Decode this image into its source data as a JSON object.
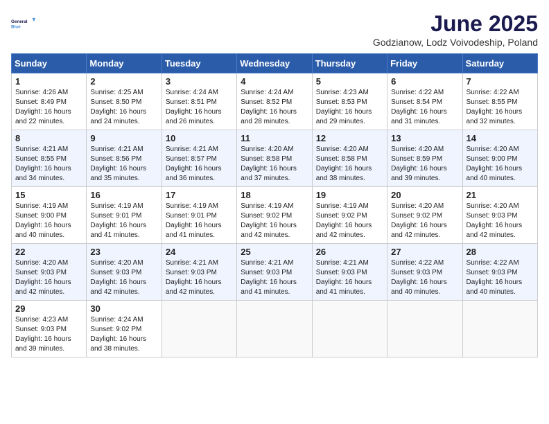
{
  "header": {
    "logo_line1": "General",
    "logo_line2": "Blue",
    "title": "June 2025",
    "subtitle": "Godzianow, Lodz Voivodeship, Poland"
  },
  "days_of_week": [
    "Sunday",
    "Monday",
    "Tuesday",
    "Wednesday",
    "Thursday",
    "Friday",
    "Saturday"
  ],
  "weeks": [
    [
      {
        "day": "1",
        "info": "Sunrise: 4:26 AM\nSunset: 8:49 PM\nDaylight: 16 hours\nand 22 minutes."
      },
      {
        "day": "2",
        "info": "Sunrise: 4:25 AM\nSunset: 8:50 PM\nDaylight: 16 hours\nand 24 minutes."
      },
      {
        "day": "3",
        "info": "Sunrise: 4:24 AM\nSunset: 8:51 PM\nDaylight: 16 hours\nand 26 minutes."
      },
      {
        "day": "4",
        "info": "Sunrise: 4:24 AM\nSunset: 8:52 PM\nDaylight: 16 hours\nand 28 minutes."
      },
      {
        "day": "5",
        "info": "Sunrise: 4:23 AM\nSunset: 8:53 PM\nDaylight: 16 hours\nand 29 minutes."
      },
      {
        "day": "6",
        "info": "Sunrise: 4:22 AM\nSunset: 8:54 PM\nDaylight: 16 hours\nand 31 minutes."
      },
      {
        "day": "7",
        "info": "Sunrise: 4:22 AM\nSunset: 8:55 PM\nDaylight: 16 hours\nand 32 minutes."
      }
    ],
    [
      {
        "day": "8",
        "info": "Sunrise: 4:21 AM\nSunset: 8:55 PM\nDaylight: 16 hours\nand 34 minutes."
      },
      {
        "day": "9",
        "info": "Sunrise: 4:21 AM\nSunset: 8:56 PM\nDaylight: 16 hours\nand 35 minutes."
      },
      {
        "day": "10",
        "info": "Sunrise: 4:21 AM\nSunset: 8:57 PM\nDaylight: 16 hours\nand 36 minutes."
      },
      {
        "day": "11",
        "info": "Sunrise: 4:20 AM\nSunset: 8:58 PM\nDaylight: 16 hours\nand 37 minutes."
      },
      {
        "day": "12",
        "info": "Sunrise: 4:20 AM\nSunset: 8:58 PM\nDaylight: 16 hours\nand 38 minutes."
      },
      {
        "day": "13",
        "info": "Sunrise: 4:20 AM\nSunset: 8:59 PM\nDaylight: 16 hours\nand 39 minutes."
      },
      {
        "day": "14",
        "info": "Sunrise: 4:20 AM\nSunset: 9:00 PM\nDaylight: 16 hours\nand 40 minutes."
      }
    ],
    [
      {
        "day": "15",
        "info": "Sunrise: 4:19 AM\nSunset: 9:00 PM\nDaylight: 16 hours\nand 40 minutes."
      },
      {
        "day": "16",
        "info": "Sunrise: 4:19 AM\nSunset: 9:01 PM\nDaylight: 16 hours\nand 41 minutes."
      },
      {
        "day": "17",
        "info": "Sunrise: 4:19 AM\nSunset: 9:01 PM\nDaylight: 16 hours\nand 41 minutes."
      },
      {
        "day": "18",
        "info": "Sunrise: 4:19 AM\nSunset: 9:02 PM\nDaylight: 16 hours\nand 42 minutes."
      },
      {
        "day": "19",
        "info": "Sunrise: 4:19 AM\nSunset: 9:02 PM\nDaylight: 16 hours\nand 42 minutes."
      },
      {
        "day": "20",
        "info": "Sunrise: 4:20 AM\nSunset: 9:02 PM\nDaylight: 16 hours\nand 42 minutes."
      },
      {
        "day": "21",
        "info": "Sunrise: 4:20 AM\nSunset: 9:03 PM\nDaylight: 16 hours\nand 42 minutes."
      }
    ],
    [
      {
        "day": "22",
        "info": "Sunrise: 4:20 AM\nSunset: 9:03 PM\nDaylight: 16 hours\nand 42 minutes."
      },
      {
        "day": "23",
        "info": "Sunrise: 4:20 AM\nSunset: 9:03 PM\nDaylight: 16 hours\nand 42 minutes."
      },
      {
        "day": "24",
        "info": "Sunrise: 4:21 AM\nSunset: 9:03 PM\nDaylight: 16 hours\nand 42 minutes."
      },
      {
        "day": "25",
        "info": "Sunrise: 4:21 AM\nSunset: 9:03 PM\nDaylight: 16 hours\nand 41 minutes."
      },
      {
        "day": "26",
        "info": "Sunrise: 4:21 AM\nSunset: 9:03 PM\nDaylight: 16 hours\nand 41 minutes."
      },
      {
        "day": "27",
        "info": "Sunrise: 4:22 AM\nSunset: 9:03 PM\nDaylight: 16 hours\nand 40 minutes."
      },
      {
        "day": "28",
        "info": "Sunrise: 4:22 AM\nSunset: 9:03 PM\nDaylight: 16 hours\nand 40 minutes."
      }
    ],
    [
      {
        "day": "29",
        "info": "Sunrise: 4:23 AM\nSunset: 9:03 PM\nDaylight: 16 hours\nand 39 minutes."
      },
      {
        "day": "30",
        "info": "Sunrise: 4:24 AM\nSunset: 9:02 PM\nDaylight: 16 hours\nand 38 minutes."
      },
      {
        "day": "",
        "info": ""
      },
      {
        "day": "",
        "info": ""
      },
      {
        "day": "",
        "info": ""
      },
      {
        "day": "",
        "info": ""
      },
      {
        "day": "",
        "info": ""
      }
    ]
  ]
}
